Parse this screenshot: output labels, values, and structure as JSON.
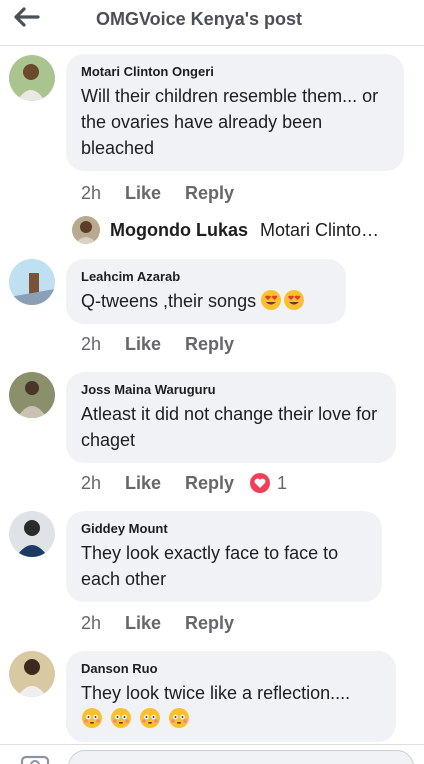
{
  "header": {
    "title": "OMGVoice Kenya's post",
    "back_icon": "arrow-left-icon"
  },
  "comments": [
    {
      "author": "Motari Clinton Ongeri",
      "text": "Will their children resemble them... or the ovaries have already been bleached",
      "time": "2h",
      "like": "Like",
      "reply": "Reply"
    },
    {
      "author": "Leahcim Azarab",
      "text": "Q-tweens ,their songs",
      "emojis": [
        "heart-eyes-emoji",
        "heart-eyes-emoji"
      ],
      "time": "2h",
      "like": "Like",
      "reply": "Reply"
    },
    {
      "author": "Joss Maina Waruguru",
      "text": "Atleast it did not change their love for chaget",
      "time": "2h",
      "like": "Like",
      "reply": "Reply",
      "reaction": {
        "icon": "love-reaction-icon",
        "count": "1"
      }
    },
    {
      "author": "Giddey Mount",
      "text": "They look exactly face to face to each other",
      "time": "2h",
      "like": "Like",
      "reply": "Reply"
    },
    {
      "author": "Danson Ruo",
      "text": "They look twice like a reflection....",
      "emojis": [
        "flushed-face-emoji",
        "flushed-face-emoji",
        "flushed-face-emoji",
        "flushed-face-emoji"
      ]
    }
  ],
  "reply_preview": {
    "author": "Mogondo Lukas",
    "text": "Motari Clinto…"
  },
  "composer": {
    "camera_icon": "camera-icon"
  },
  "colors": {
    "bubble": "#f0f2f5",
    "meta_text": "#65676b",
    "love": "#f33e58",
    "emoji_yellow": "#fbc02d"
  }
}
